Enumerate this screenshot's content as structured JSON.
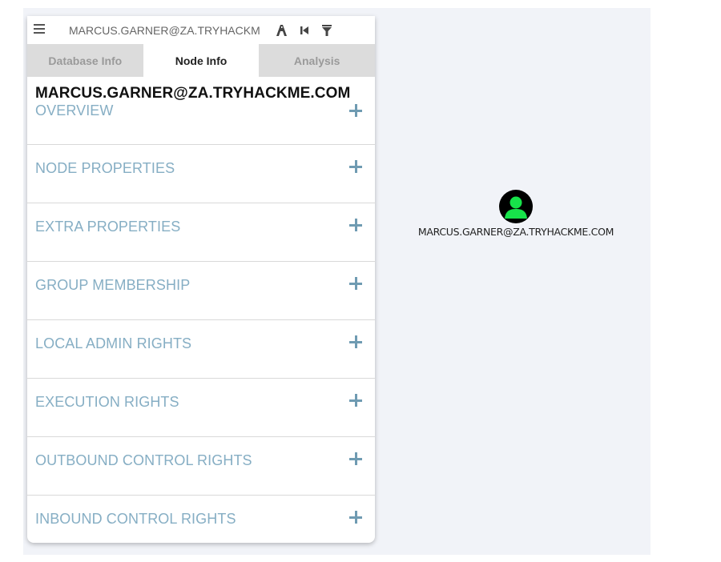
{
  "search": {
    "value": "MARCUS.GARNER@ZA.TRYHACKM",
    "menu_icon": "hamburger-menu-icon",
    "tool_icons": [
      "pathfinding-icon",
      "back-icon",
      "filter-icon"
    ]
  },
  "tabs": [
    {
      "label": "Database Info",
      "active": false
    },
    {
      "label": "Node Info",
      "active": true
    },
    {
      "label": "Analysis",
      "active": false
    }
  ],
  "node_info": {
    "title": "MARCUS.GARNER@ZA.TRYHACKME.COM",
    "sections": [
      {
        "label": "OVERVIEW"
      },
      {
        "label": "NODE PROPERTIES"
      },
      {
        "label": "EXTRA PROPERTIES"
      },
      {
        "label": "GROUP MEMBERSHIP"
      },
      {
        "label": "LOCAL ADMIN RIGHTS"
      },
      {
        "label": "EXECUTION RIGHTS"
      },
      {
        "label": "OUTBOUND CONTROL RIGHTS"
      },
      {
        "label": "INBOUND CONTROL RIGHTS"
      }
    ]
  },
  "graph": {
    "node_label": "MARCUS.GARNER@ZA.TRYHACKME.COM",
    "node_icon": "user-icon",
    "node_color": "#17e34a"
  },
  "colors": {
    "section_label": "#86aec4",
    "plus_icon": "#6f9bb2",
    "canvas_bg": "#f1f3f8"
  }
}
